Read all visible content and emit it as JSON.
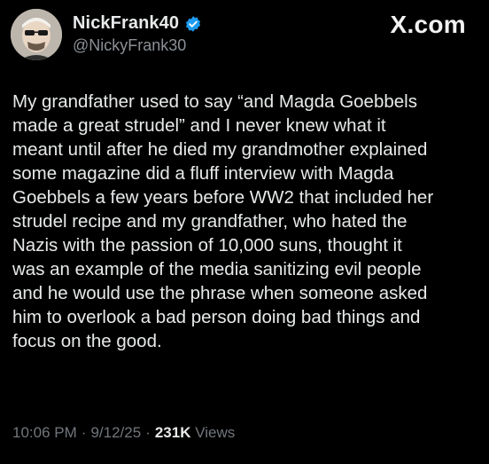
{
  "post": {
    "author": {
      "display_name": "NickFrank40",
      "handle": "@NickyFrank30",
      "verified_icon": "verified-badge-icon",
      "verified_color": "#1d9bf0"
    },
    "brand": "X.com",
    "text": "My grandfather used to say “and Magda Goebbels\nmade a great strudel” and I never knew what it\nmeant until after he died my grandmother explained\nsome magazine did a fluff interview with Magda\nGoebbels a few years before WW2 that included her\nstrudel recipe and my grandfather, who hated the\nNazis with the passion of 10,000 suns, thought it\nwas an example of the media sanitizing evil people\nand he would use the phrase when someone asked\nhim to overlook a bad person doing bad things and\nfocus on the good.",
    "meta": {
      "time": "10:06 PM",
      "separator": "·",
      "date": "9/12/25",
      "views_count": "231K",
      "views_label": "Views"
    }
  },
  "colors": {
    "background": "#000000",
    "primary_text": "#e7e9ea",
    "secondary_text": "#71767b"
  }
}
